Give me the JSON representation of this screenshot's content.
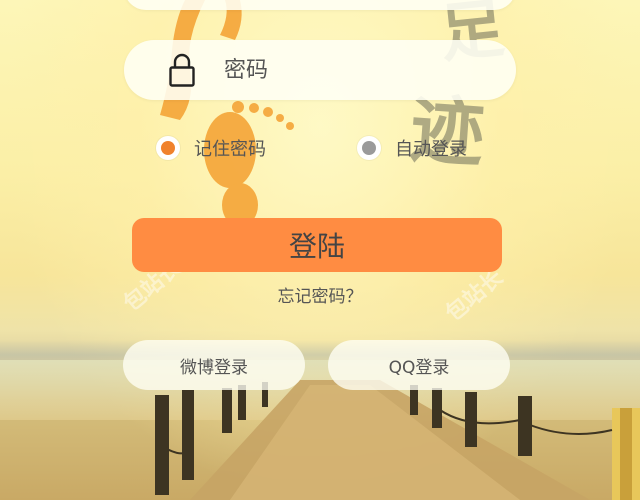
{
  "colors": {
    "accent": "#ff8c42",
    "radio_on": "#f0822c",
    "radio_off": "#9a9a9a",
    "text": "#555555",
    "footprint": "#f4a030"
  },
  "password": {
    "placeholder": "密码",
    "value": "",
    "icon": "lock-icon"
  },
  "options": {
    "remember": {
      "label": "记住密码",
      "checked": true
    },
    "auto_login": {
      "label": "自动登录",
      "checked": false
    }
  },
  "login_button": {
    "label": "登陆"
  },
  "forgot_link": {
    "label": "忘记密码？"
  },
  "social": {
    "weibo": {
      "label": "微博登录"
    },
    "qq": {
      "label": "QQ登录"
    }
  },
  "decor": {
    "watermark_text": "包站长"
  }
}
